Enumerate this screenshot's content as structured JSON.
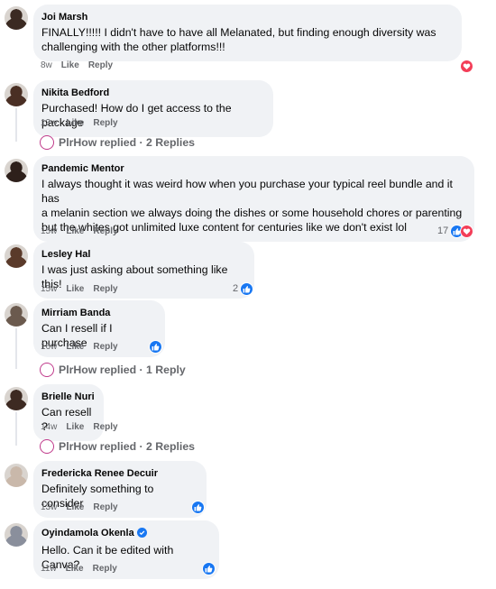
{
  "comments": [
    {
      "author": "Joi Marsh",
      "lines": [
        "FINALLY!!!!! I didn't have to have all Melanated, but finding enough diversity was",
        "challenging with the other platforms!!!"
      ],
      "time": "8w",
      "like_label": "Like",
      "reply_label": "Reply",
      "reactions": {
        "types": [
          "love"
        ],
        "count": ""
      }
    },
    {
      "author": "Nikita Bedford",
      "lines": [
        "Purchased! How do I get access to the package"
      ],
      "time": "13w",
      "like_label": "Like",
      "reply_label": "Reply",
      "reactions": {
        "types": [],
        "count": ""
      },
      "replies": {
        "page": "PlrHow",
        "text": "PlrHow replied · 2 Replies"
      }
    },
    {
      "author": "Pandemic Mentor",
      "lines": [
        "I always thought it was weird how when you purchase your typical reel bundle and it has",
        "a melanin section we always doing the dishes or some household chores or parenting",
        "but the whites got unlimited luxe content for centuries like we don't exist lol"
      ],
      "time": "15w",
      "like_label": "Like",
      "reply_label": "Reply",
      "reactions": {
        "types": [
          "like",
          "love"
        ],
        "count": "17"
      }
    },
    {
      "author": "Lesley Hal",
      "lines": [
        "I was just asking about something like this!"
      ],
      "time": "15w",
      "like_label": "Like",
      "reply_label": "Reply",
      "reactions": {
        "types": [
          "like"
        ],
        "count": "2"
      }
    },
    {
      "author": "Mirriam Banda",
      "lines": [
        "Can I resell if I purchase"
      ],
      "time": "16w",
      "like_label": "Like",
      "reply_label": "Reply",
      "reactions": {
        "types": [
          "like"
        ],
        "count": ""
      },
      "replies": {
        "page": "PlrHow",
        "text": "PlrHow replied · 1 Reply"
      }
    },
    {
      "author": "Brielle Nuri",
      "lines": [
        "Can resell ?"
      ],
      "time": "14w",
      "like_label": "Like",
      "reply_label": "Reply",
      "reactions": {
        "types": [],
        "count": ""
      },
      "replies": {
        "page": "PlrHow",
        "text": "PlrHow replied · 2 Replies"
      }
    },
    {
      "author": "Fredericka Renee Decuir",
      "lines": [
        "Definitely something to consider"
      ],
      "time": "13w",
      "like_label": "Like",
      "reply_label": "Reply",
      "reactions": {
        "types": [
          "like"
        ],
        "count": ""
      }
    },
    {
      "author": "Oyindamola Okenla",
      "verified": true,
      "lines": [
        "Hello. Can it be edited with Canva?"
      ],
      "time": "11w",
      "like_label": "Like",
      "reply_label": "Reply",
      "reactions": {
        "types": [
          "like"
        ],
        "count": ""
      }
    }
  ],
  "avatar_colors": [
    "#3b2a22",
    "#4a2f24",
    "#2e201b",
    "#5a3a2a",
    "#6b5a4e",
    "#3d2a22",
    "#c9b8aa",
    "#8a8f9c"
  ],
  "icons": {
    "like": "thumbs-up-icon",
    "love": "heart-icon",
    "verified": "verified-badge-icon"
  },
  "colors": {
    "like": "#1877f2",
    "love": "#f33e58",
    "bubble": "#f0f2f5",
    "meta": "#65676b"
  }
}
